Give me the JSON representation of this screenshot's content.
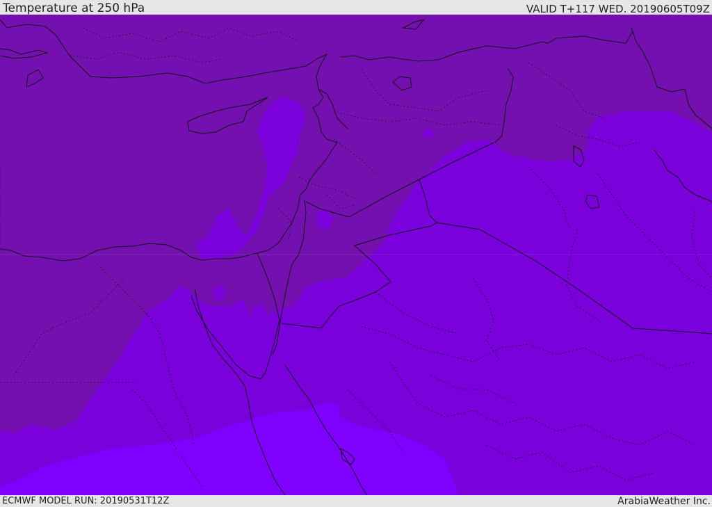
{
  "header": {
    "title": "Temperature at 250 hPa",
    "valid_time": "VALID T+117 WED. 20190605T09Z"
  },
  "footer": {
    "model_run": "ECMWF MODEL RUN: 20190531T12Z",
    "credit": "ArabiaWeather Inc."
  },
  "map": {
    "colors": {
      "band_warm": "#7510b0",
      "band_mid": "#7a00dc",
      "band_cold": "#8000ff",
      "border_line": "#111111",
      "frame": "#e6e6e6"
    }
  }
}
